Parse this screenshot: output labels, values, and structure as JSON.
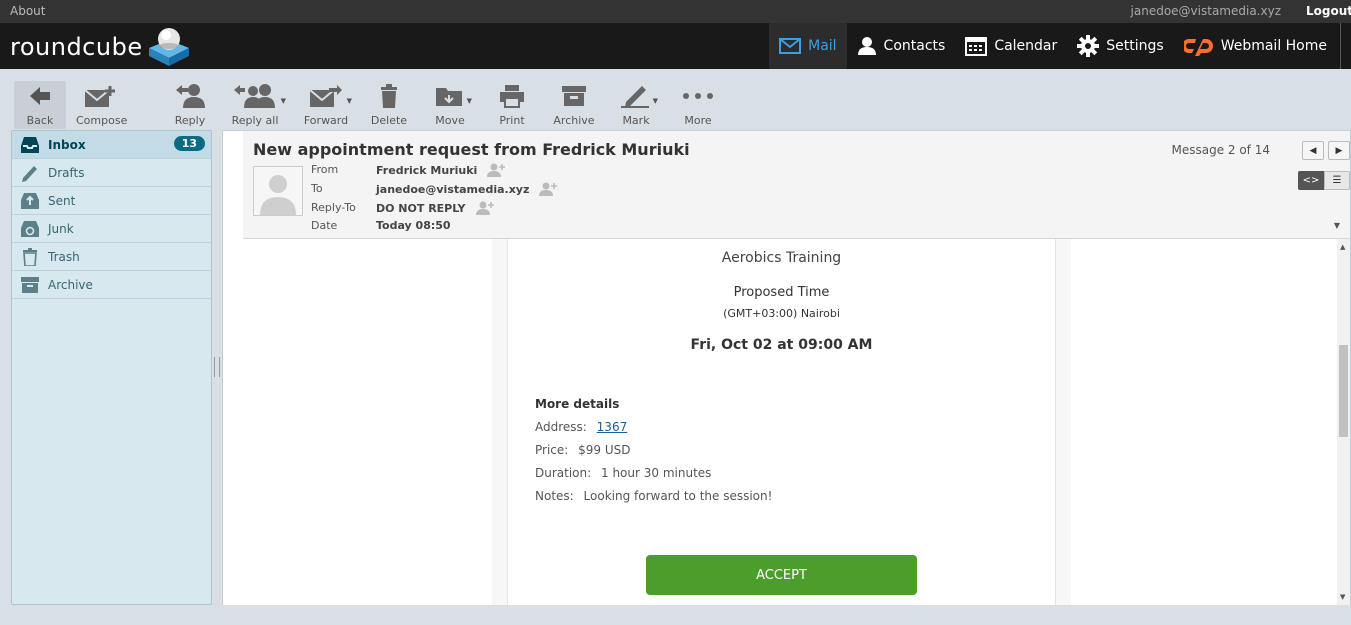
{
  "topbar": {
    "about": "About",
    "user": "janedoe@vistamedia.xyz",
    "logout": "Logout"
  },
  "logo": {
    "text": "roundcube"
  },
  "topnav": [
    {
      "label": "Mail",
      "icon": "envelope-icon",
      "active": true
    },
    {
      "label": "Contacts",
      "icon": "person-icon"
    },
    {
      "label": "Calendar",
      "icon": "calendar-icon"
    },
    {
      "label": "Settings",
      "icon": "gear-icon"
    },
    {
      "label": "Webmail Home",
      "icon": "cpanel-icon"
    }
  ],
  "toolbar": {
    "back": "Back",
    "compose": "Compose",
    "reply": "Reply",
    "reply_all": "Reply all",
    "forward": "Forward",
    "delete": "Delete",
    "move": "Move",
    "print": "Print",
    "archive": "Archive",
    "mark": "Mark",
    "more": "More"
  },
  "folders": [
    {
      "name": "Inbox",
      "count": "13",
      "active": true
    },
    {
      "name": "Drafts"
    },
    {
      "name": "Sent"
    },
    {
      "name": "Junk"
    },
    {
      "name": "Trash"
    },
    {
      "name": "Archive"
    }
  ],
  "message": {
    "subject": "New appointment request from Fredrick Muriuki",
    "counter": "Message 2 of 14",
    "headers": {
      "from_label": "From",
      "from": "Fredrick Muriuki",
      "to_label": "To",
      "to": "janedoe@vistamedia.xyz",
      "replyto_label": "Reply-To",
      "replyto": "DO NOT REPLY",
      "date_label": "Date",
      "date": "Today 08:50"
    },
    "body": {
      "service": "Aerobics Training",
      "proposed_label": "Proposed Time",
      "timezone": "(GMT+03:00) Nairobi",
      "when": "Fri, Oct 02 at 09:00 AM",
      "more_details": "More details",
      "address_label": "Address:",
      "address": "1367",
      "price_label": "Price:",
      "price": "$99 USD",
      "duration_label": "Duration:",
      "duration": "1 hour 30 minutes",
      "notes_label": "Notes:",
      "notes": "Looking forward to the session!",
      "accept": "ACCEPT"
    }
  },
  "colors": {
    "accent": "#3c9fe1",
    "accept": "#4b9e2c",
    "badge": "#0d6a85",
    "header": "#191919"
  }
}
